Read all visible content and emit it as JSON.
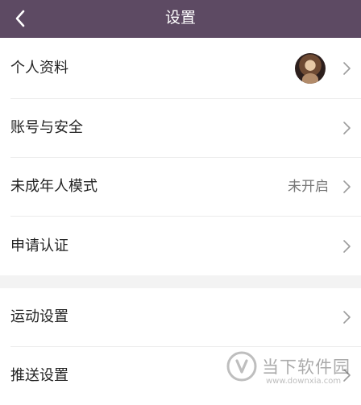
{
  "header": {
    "title": "设置",
    "back_icon": "chevron-left-icon"
  },
  "settings": {
    "group1": [
      {
        "label": "个人资料",
        "value": "",
        "has_avatar": true
      },
      {
        "label": "账号与安全",
        "value": ""
      },
      {
        "label": "未成年人模式",
        "value": "未开启"
      },
      {
        "label": "申请认证",
        "value": ""
      }
    ],
    "group2": [
      {
        "label": "运动设置",
        "value": ""
      },
      {
        "label": "推送设置",
        "value": ""
      }
    ]
  },
  "watermark": {
    "name": "当下软件园",
    "url": "www.downxia.com"
  },
  "colors": {
    "header_bg": "#5d4a63",
    "separator_bg": "#f3f3f3"
  }
}
